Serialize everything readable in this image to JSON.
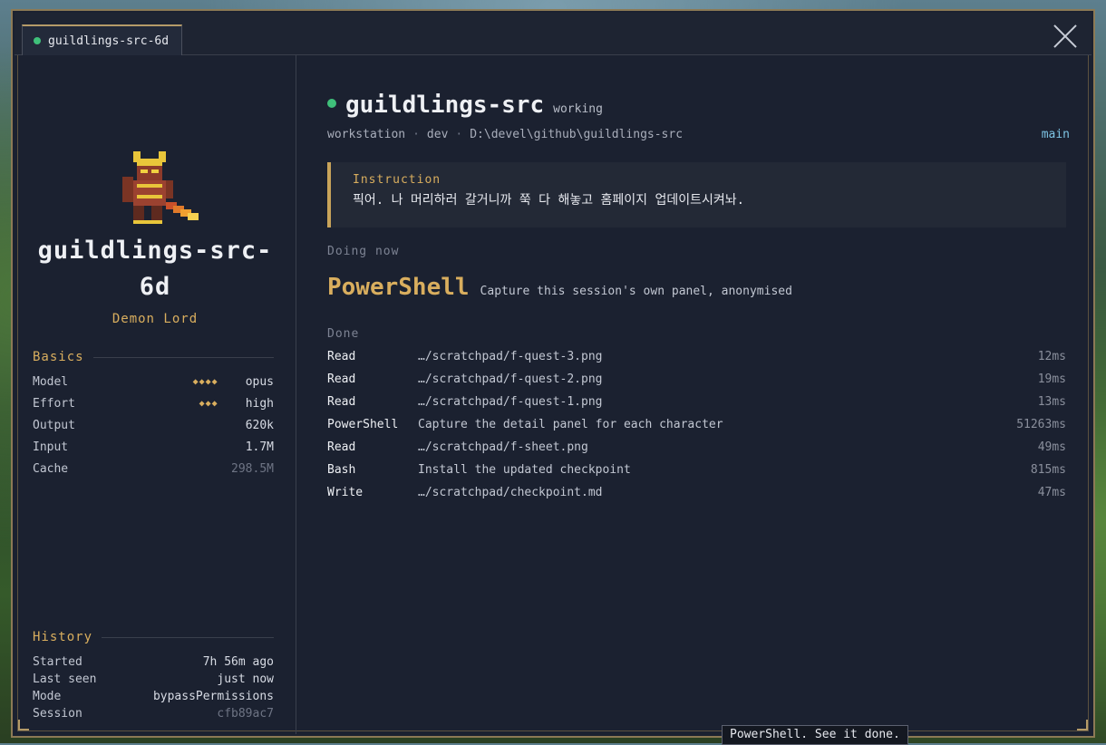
{
  "window": {
    "tab_label": "guildlings-src-6d"
  },
  "sidebar": {
    "agent_name": "guildlings-src-6d",
    "agent_class": "Demon Lord",
    "basics_heading": "Basics",
    "basics": {
      "model_label": "Model",
      "model_pips": "◆◆◆◆",
      "model_value": "opus",
      "effort_label": "Effort",
      "effort_pips": "◆◆◆",
      "effort_value": "high",
      "output_label": "Output",
      "output_value": "620k",
      "input_label": "Input",
      "input_value": "1.7M",
      "cache_label": "Cache",
      "cache_value": "298.5M"
    },
    "history_heading": "History",
    "history": {
      "started_label": "Started",
      "started_value": "7h 56m ago",
      "last_seen_label": "Last seen",
      "last_seen_value": "just now",
      "mode_label": "Mode",
      "mode_value": "bypassPermissions",
      "session_label": "Session",
      "session_value": "cfb89ac7"
    }
  },
  "main": {
    "title": "guildlings-src",
    "status": "working",
    "meta_host": "workstation",
    "meta_env": "dev",
    "meta_path": "D:\\devel\\github\\guildlings-src",
    "branch": "main",
    "instruction_label": "Instruction",
    "instruction_text": "픽어. 나 머리하러 갈거니까 쭉 다 해놓고 홈페이지 업데이트시켜놔.",
    "doing_label": "Doing now",
    "doing_tool": "PowerShell",
    "doing_desc": "Capture this session's own panel, anonymised",
    "done_label": "Done",
    "done": [
      {
        "tool": "Read",
        "detail": "…/scratchpad/f-quest-3.png",
        "ms": "12ms"
      },
      {
        "tool": "Read",
        "detail": "…/scratchpad/f-quest-2.png",
        "ms": "19ms"
      },
      {
        "tool": "Read",
        "detail": "…/scratchpad/f-quest-1.png",
        "ms": "13ms"
      },
      {
        "tool": "PowerShell",
        "detail": "Capture the detail panel for each character",
        "ms": "51263ms"
      },
      {
        "tool": "Read",
        "detail": "…/scratchpad/f-sheet.png",
        "ms": "49ms"
      },
      {
        "tool": "Bash",
        "detail": "Install the updated checkpoint",
        "ms": "815ms"
      },
      {
        "tool": "Write",
        "detail": "…/scratchpad/checkpoint.md",
        "ms": "47ms"
      }
    ]
  },
  "tooltip": "PowerShell. See it done.",
  "colors": {
    "accent_gold": "#d9ae5e",
    "status_green": "#3fc07a",
    "branch_blue": "#7dc4e4",
    "panel_bg": "#1b2130"
  }
}
